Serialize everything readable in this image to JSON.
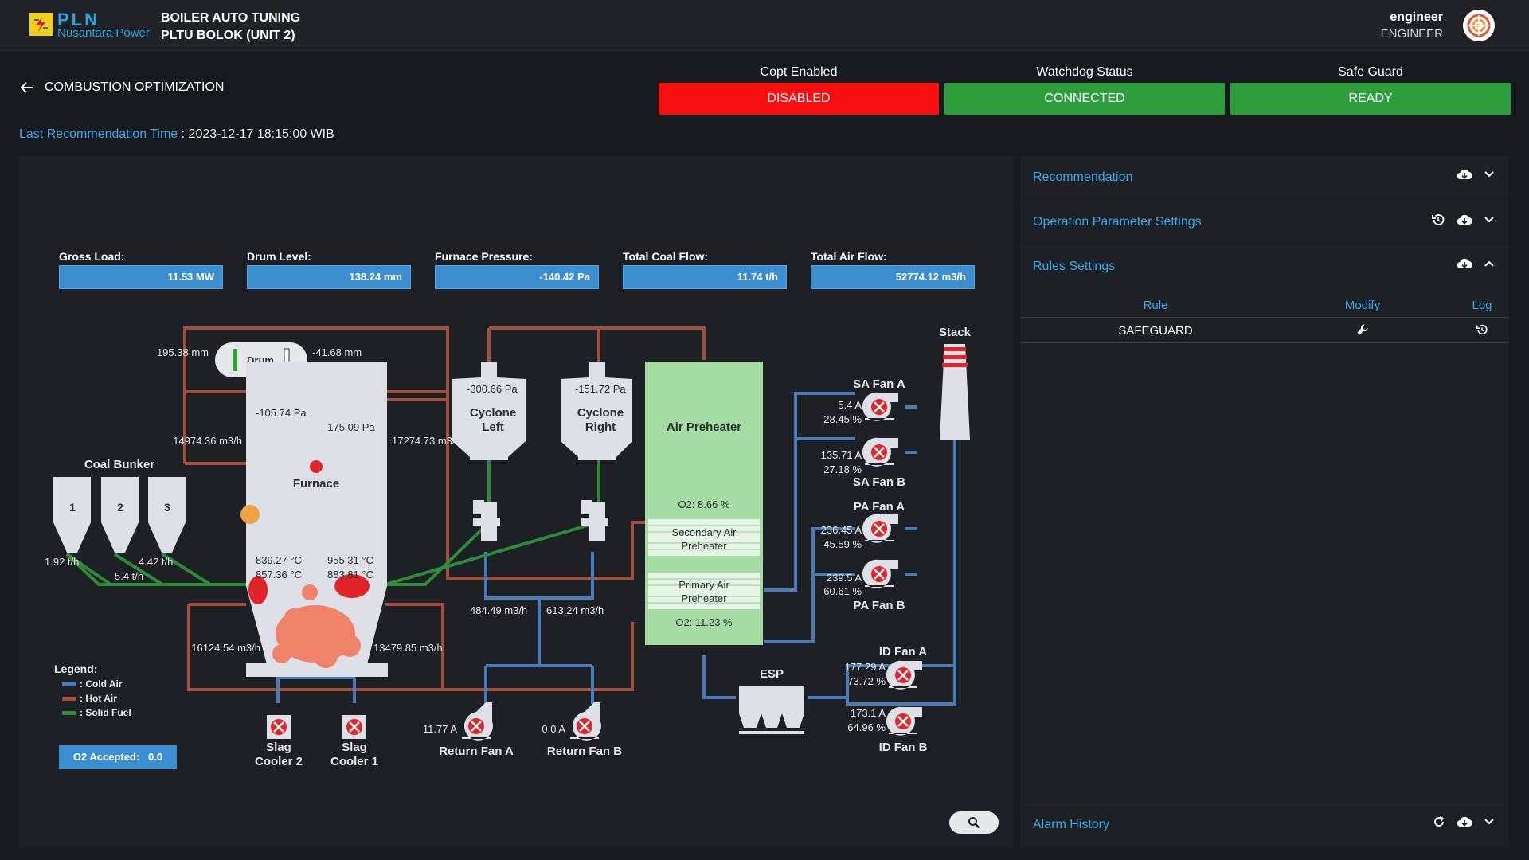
{
  "header": {
    "brand": "PLN",
    "brand_sub": "Nusantara Power",
    "app_title": "BOILER AUTO TUNING",
    "app_subtitle": "PLTU BOLOK (UNIT 2)",
    "user_name": "engineer",
    "user_role": "ENGINEER"
  },
  "page": {
    "back_label": "COMBUSTION OPTIMIZATION",
    "last_rec_label": "Last Recommendation Time",
    "last_rec_value": " : 2023-12-17 18:15:00 WIB"
  },
  "status": [
    {
      "label": "Copt Enabled",
      "value": "DISABLED",
      "color": "#f70e0e"
    },
    {
      "label": "Watchdog Status",
      "value": "CONNECTED",
      "color": "#2e9d3c"
    },
    {
      "label": "Safe Guard",
      "value": "READY",
      "color": "#2e9d3c"
    }
  ],
  "metrics": [
    {
      "label": "Gross Load:",
      "value": "11.53 MW"
    },
    {
      "label": "Drum Level:",
      "value": "138.24 mm"
    },
    {
      "label": "Furnace Pressure:",
      "value": "-140.42 Pa"
    },
    {
      "label": "Total Coal Flow:",
      "value": "11.74 t/h"
    },
    {
      "label": "Total Air Flow:",
      "value": "52774.12 m3/h"
    }
  ],
  "diagram": {
    "drum_label": "Drum",
    "drum_left": "195.38 mm",
    "drum_right": "-41.68 mm",
    "furnace_label": "Furnace",
    "furnace_p1": "-105.74 Pa",
    "furnace_p2": "-175.09 Pa",
    "air_left_top": "14974.36 m3/h",
    "air_right_top": "17274.73 m3/h",
    "temp1": "839.27 °C",
    "temp2": "955.31 °C",
    "temp3": "857.36 °C",
    "temp4": "883.81 °C",
    "air_left_bottom": "16124.54 m3/h",
    "air_right_bottom": "13479.85 m3/h",
    "coal_bunker": "Coal Bunker",
    "bunkers": [
      "1",
      "2",
      "3"
    ],
    "coal1": "1.92 t/h",
    "coal2": "5.4 t/h",
    "coal3": "4.42 t/h",
    "cyclone_left": [
      "Cyclone",
      "Left"
    ],
    "cyclone_right": [
      "Cyclone",
      "Right"
    ],
    "cyclone_left_p": "-300.66 Pa",
    "cyclone_right_p": "-151.72 Pa",
    "return_flow_a": "484.49 m3/h",
    "return_flow_b": "613.24 m3/h",
    "return_fan_a": "Return Fan A",
    "return_fan_b": "Return Fan B",
    "return_fan_a_amp": "11.77 A",
    "return_fan_b_amp": "0.0 A",
    "slag2": [
      "Slag",
      "Cooler 2"
    ],
    "slag1": [
      "Slag",
      "Cooler 1"
    ],
    "air_preheater": "Air Preheater",
    "o2_top": "O2: 8.66 %",
    "secondary_ap": [
      "Secondary Air",
      "Preheater"
    ],
    "primary_ap": [
      "Primary Air",
      "Preheater"
    ],
    "o2_bottom": "O2: 11.23 %",
    "esp": "ESP",
    "stack": "Stack",
    "sa_fan_a": "SA Fan A",
    "sa_fan_a_amp": "5.4 A",
    "sa_fan_a_pct": "28.45 %",
    "sa_fan_b": "SA Fan B",
    "sa_fan_b_amp": "135.71 A",
    "sa_fan_b_pct": "27.18 %",
    "pa_fan_a": "PA Fan A",
    "pa_fan_a_amp": "236.45 A",
    "pa_fan_a_pct": "45.59 %",
    "pa_fan_b": "PA Fan B",
    "pa_fan_b_amp": "239.5 A",
    "pa_fan_b_pct": "60.61 %",
    "id_fan_a": "ID Fan A",
    "id_fan_a_amp": "177.29 A",
    "id_fan_a_pct": "73.72 %",
    "id_fan_b": "ID Fan B",
    "id_fan_b_amp": "173.1 A",
    "id_fan_b_pct": "64.96 %"
  },
  "legend": {
    "title": "Legend:",
    "items": [
      {
        "label": ": Cold Air",
        "color": "#4a7bb7"
      },
      {
        "label": ": Hot Air",
        "color": "#a0503c"
      },
      {
        "label": ": Solid Fuel",
        "color": "#2e8b3a"
      }
    ]
  },
  "o2_accepted": {
    "label": "O2 Accepted:",
    "value": "0.0"
  },
  "panel": {
    "recommendation": "Recommendation",
    "operation_params": "Operation Parameter Settings",
    "rules_settings": "Rules Settings",
    "rules_headers": [
      "Rule",
      "Modify",
      "Log"
    ],
    "rules_rows": [
      {
        "rule": "SAFEGUARD"
      }
    ],
    "alarm_history": "Alarm History"
  },
  "icons": [
    "lightning-icon",
    "avatar-icon",
    "back-arrow-icon",
    "cloud-download-icon",
    "chevron-down-icon",
    "chevron-up-icon",
    "history-icon",
    "wrench-icon",
    "refresh-icon",
    "zoom-icon",
    "fan-icon"
  ]
}
